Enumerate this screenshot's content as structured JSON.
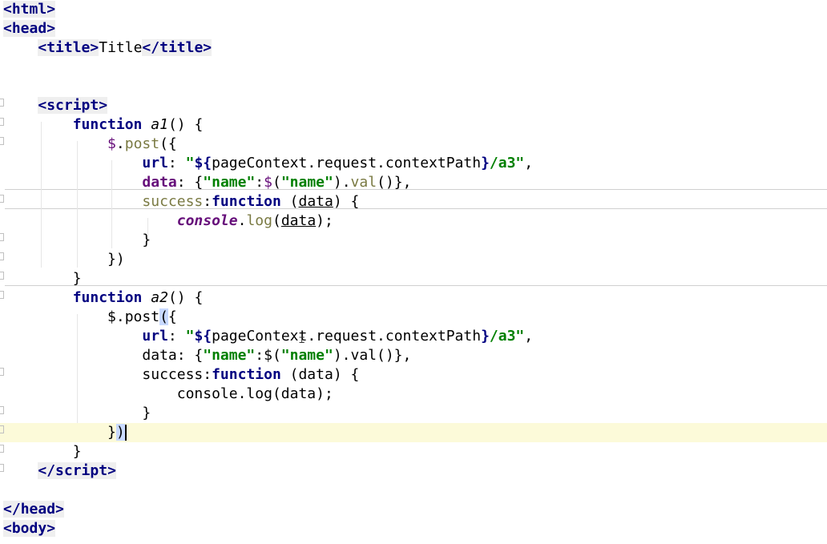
{
  "editor": {
    "language": "html",
    "lines": [
      {
        "tokens": [
          {
            "t": "<",
            "c": "tagbr"
          },
          {
            "t": "html",
            "c": "tag"
          },
          {
            "t": ">",
            "c": "tagbr"
          }
        ]
      },
      {
        "tokens": [
          {
            "t": "<",
            "c": "tagbr"
          },
          {
            "t": "head",
            "c": "tag"
          },
          {
            "t": ">",
            "c": "tagbr"
          }
        ]
      },
      {
        "tokens": [
          {
            "t": "    ",
            "c": ""
          },
          {
            "t": "<",
            "c": "tagbr"
          },
          {
            "t": "title",
            "c": "tag"
          },
          {
            "t": ">",
            "c": "tagbr"
          },
          {
            "t": "Title",
            "c": ""
          },
          {
            "t": "</",
            "c": "tagbr"
          },
          {
            "t": "title",
            "c": "tag"
          },
          {
            "t": ">",
            "c": "tagbr"
          }
        ]
      },
      {
        "tokens": []
      },
      {
        "tokens": []
      },
      {
        "tokens": [
          {
            "t": "    ",
            "c": ""
          },
          {
            "t": "<",
            "c": "tagbr"
          },
          {
            "t": "script",
            "c": "tag"
          },
          {
            "t": ">",
            "c": "tagbr"
          }
        ]
      },
      {
        "tokens": [
          {
            "t": "        ",
            "c": ""
          },
          {
            "t": "function",
            "c": "kw"
          },
          {
            "t": " ",
            "c": ""
          },
          {
            "t": "a1",
            "c": "fn"
          },
          {
            "t": "() {",
            "c": ""
          }
        ]
      },
      {
        "tokens": [
          {
            "t": "            ",
            "c": ""
          },
          {
            "t": "$",
            "c": "dollar"
          },
          {
            "t": ".",
            "c": ""
          },
          {
            "t": "post",
            "c": "meth"
          },
          {
            "t": "({",
            "c": ""
          }
        ]
      },
      {
        "tokens": [
          {
            "t": "                ",
            "c": ""
          },
          {
            "t": "url",
            "c": "kw"
          },
          {
            "t": ": ",
            "c": ""
          },
          {
            "t": "\"",
            "c": "str"
          },
          {
            "t": "${",
            "c": "kwb"
          },
          {
            "t": "pageContext.request.contextPath",
            "c": ""
          },
          {
            "t": "}",
            "c": "kwb"
          },
          {
            "t": "/a3\"",
            "c": "str"
          },
          {
            "t": ",",
            "c": ""
          }
        ]
      },
      {
        "tokens": [
          {
            "t": "                ",
            "c": ""
          },
          {
            "t": "data",
            "c": "prop"
          },
          {
            "t": ": {",
            "c": ""
          },
          {
            "t": "\"name\"",
            "c": "str"
          },
          {
            "t": ":",
            "c": ""
          },
          {
            "t": "$",
            "c": "dollar"
          },
          {
            "t": "(",
            "c": ""
          },
          {
            "t": "\"name\"",
            "c": "str"
          },
          {
            "t": ").",
            "c": ""
          },
          {
            "t": "val",
            "c": "meth"
          },
          {
            "t": "()},",
            "c": ""
          }
        ]
      },
      {
        "tokens": [
          {
            "t": "                ",
            "c": ""
          },
          {
            "t": "success",
            "c": "meth"
          },
          {
            "t": ":",
            "c": ""
          },
          {
            "t": "function",
            "c": "kw"
          },
          {
            "t": " (",
            "c": ""
          },
          {
            "t": "data",
            "c": "param"
          },
          {
            "t": ") {",
            "c": ""
          }
        ]
      },
      {
        "tokens": [
          {
            "t": "                    ",
            "c": ""
          },
          {
            "t": "console",
            "c": "cons"
          },
          {
            "t": ".",
            "c": ""
          },
          {
            "t": "log",
            "c": "meth"
          },
          {
            "t": "(",
            "c": ""
          },
          {
            "t": "data",
            "c": "param"
          },
          {
            "t": ");",
            "c": ""
          }
        ]
      },
      {
        "tokens": [
          {
            "t": "                }",
            "c": ""
          }
        ]
      },
      {
        "tokens": [
          {
            "t": "            })",
            "c": ""
          }
        ]
      },
      {
        "tokens": [
          {
            "t": "        }",
            "c": ""
          }
        ]
      },
      {
        "tokens": [
          {
            "t": "        ",
            "c": ""
          },
          {
            "t": "function",
            "c": "kw"
          },
          {
            "t": " ",
            "c": ""
          },
          {
            "t": "a2",
            "c": "fn"
          },
          {
            "t": "() {",
            "c": ""
          }
        ]
      },
      {
        "tokens": [
          {
            "t": "            $.post",
            "c": ""
          },
          {
            "t": "(",
            "c": "hl"
          },
          {
            "t": "{",
            "c": ""
          }
        ]
      },
      {
        "tokens": [
          {
            "t": "                ",
            "c": ""
          },
          {
            "t": "url",
            "c": "kw"
          },
          {
            "t": ": ",
            "c": ""
          },
          {
            "t": "\"",
            "c": "str"
          },
          {
            "t": "${",
            "c": "kwb"
          },
          {
            "t": "pageContext.request.contextPath",
            "c": ""
          },
          {
            "t": "}",
            "c": "kwb"
          },
          {
            "t": "/a3\"",
            "c": "str"
          },
          {
            "t": ",",
            "c": ""
          }
        ]
      },
      {
        "tokens": [
          {
            "t": "                data: {",
            "c": ""
          },
          {
            "t": "\"name\"",
            "c": "str"
          },
          {
            "t": ":$(",
            "c": ""
          },
          {
            "t": "\"name\"",
            "c": "str"
          },
          {
            "t": ").val()},",
            "c": ""
          }
        ]
      },
      {
        "tokens": [
          {
            "t": "                success:",
            "c": ""
          },
          {
            "t": "function",
            "c": "kw"
          },
          {
            "t": " (data) {",
            "c": ""
          }
        ]
      },
      {
        "tokens": [
          {
            "t": "                    console.log(data);",
            "c": ""
          }
        ]
      },
      {
        "tokens": [
          {
            "t": "                }",
            "c": ""
          }
        ]
      },
      {
        "tokens": [
          {
            "t": "            }",
            "c": ""
          },
          {
            "t": ")",
            "c": "hl"
          },
          {
            "t": "",
            "c": "cursor"
          }
        ],
        "current": true
      },
      {
        "tokens": [
          {
            "t": "        }",
            "c": ""
          }
        ]
      },
      {
        "tokens": [
          {
            "t": "    ",
            "c": ""
          },
          {
            "t": "</",
            "c": "tagbr"
          },
          {
            "t": "script",
            "c": "tag"
          },
          {
            "t": ">",
            "c": "tagbr"
          }
        ]
      },
      {
        "tokens": []
      },
      {
        "tokens": [
          {
            "t": "</",
            "c": "tagbr"
          },
          {
            "t": "head",
            "c": "tag"
          },
          {
            "t": ">",
            "c": "tagbr"
          }
        ]
      },
      {
        "tokens": [
          {
            "t": "<",
            "c": "tagbr"
          },
          {
            "t": "body",
            "c": "tag"
          },
          {
            "t": ">",
            "c": "tagbr"
          }
        ]
      }
    ]
  }
}
